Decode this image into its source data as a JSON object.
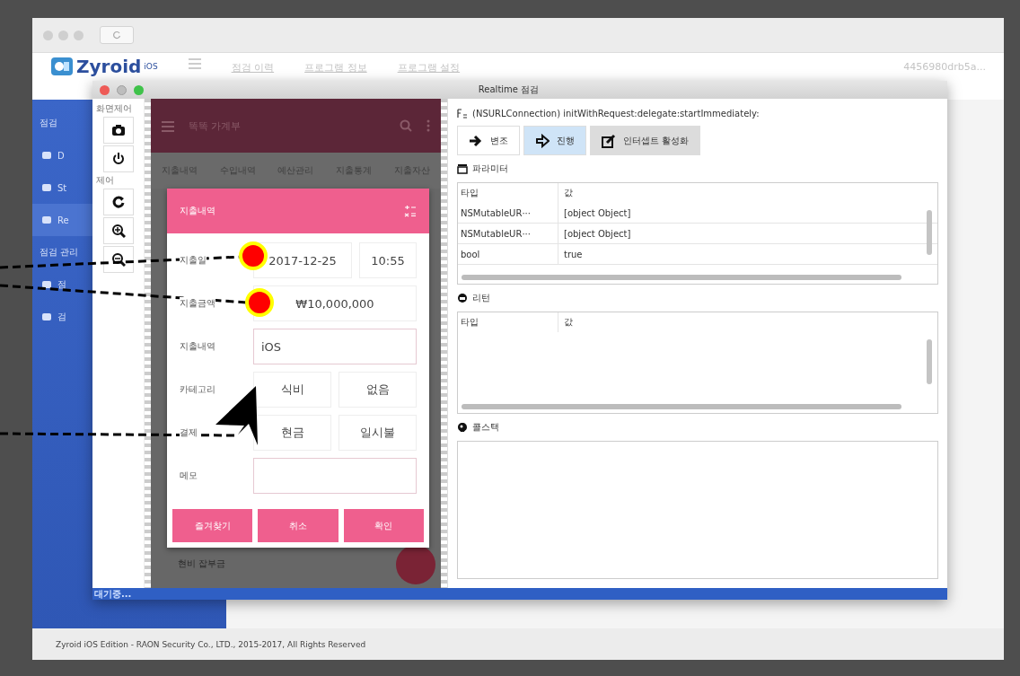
{
  "app": {
    "logo": "Zyroid",
    "logo_suffix": "iOS",
    "nav": [
      "점검 이력",
      "프로그램 정보",
      "프로그램 설정"
    ],
    "device": "4456980drb5a..."
  },
  "sidebar": {
    "items": [
      {
        "label": "점검",
        "kind": "heading",
        "selected": false
      },
      {
        "label": "D",
        "kind": "link",
        "selected": false
      },
      {
        "label": "St",
        "kind": "link",
        "selected": false
      },
      {
        "label": "Re",
        "kind": "link",
        "selected": true
      },
      {
        "label": "점검 관리",
        "kind": "heading",
        "selected": false
      },
      {
        "label": "점",
        "kind": "link",
        "selected": false
      },
      {
        "label": "검",
        "kind": "link",
        "selected": false
      }
    ]
  },
  "realtime_window": {
    "title": "Realtime 점검",
    "toolbar_groups": [
      {
        "label": "화면제어"
      },
      {
        "label": "제어"
      }
    ],
    "phone": {
      "app_title": "똑똑 가계부",
      "tabs": [
        "지출내역",
        "수입내역",
        "예산관리",
        "지출통계",
        "지출자산"
      ],
      "list_item": "현비 잡부금",
      "dialog": {
        "title": "지출내역",
        "rows": [
          {
            "kind": "pair",
            "label": "지출일",
            "values": [
              "2017-12-25",
              "10:55"
            ]
          },
          {
            "kind": "single",
            "label": "지출금액",
            "values": [
              "₩10,000,000"
            ]
          },
          {
            "kind": "input",
            "label": "지출내역",
            "values": [
              "iOS"
            ]
          },
          {
            "kind": "pair",
            "label": "카테고리",
            "values": [
              "식비",
              "없음"
            ]
          },
          {
            "kind": "pair",
            "label": "결제",
            "values": [
              "현금",
              "일시불"
            ]
          },
          {
            "kind": "input",
            "label": "메모"
          }
        ],
        "buttons": [
          "즐겨찾기",
          "취소",
          "확인"
        ]
      }
    },
    "method": "(NSURLConnection) initWithRequest:delegate:startImmediately:",
    "actions": [
      {
        "label": "변조",
        "selected": false
      },
      {
        "label": "진행",
        "selected": true
      },
      {
        "label": "인터셉트 활성화",
        "selected": false
      }
    ],
    "parameters": {
      "title": "파라미터",
      "columns": [
        "타입",
        "값"
      ],
      "rows": [
        [
          "NSMutableUR···",
          "[object Object]"
        ],
        [
          "NSMutableUR···",
          "[object Object]"
        ],
        [
          "bool",
          "true"
        ]
      ]
    },
    "return": {
      "title": "리턴",
      "columns": [
        "타입",
        "값"
      ]
    },
    "callstack": {
      "title": "콜스택"
    },
    "status": "대기중..."
  },
  "footer": "Zyroid iOS Edition - RAON Security Co., LTD., 2015-2017, All Rights Reserved"
}
